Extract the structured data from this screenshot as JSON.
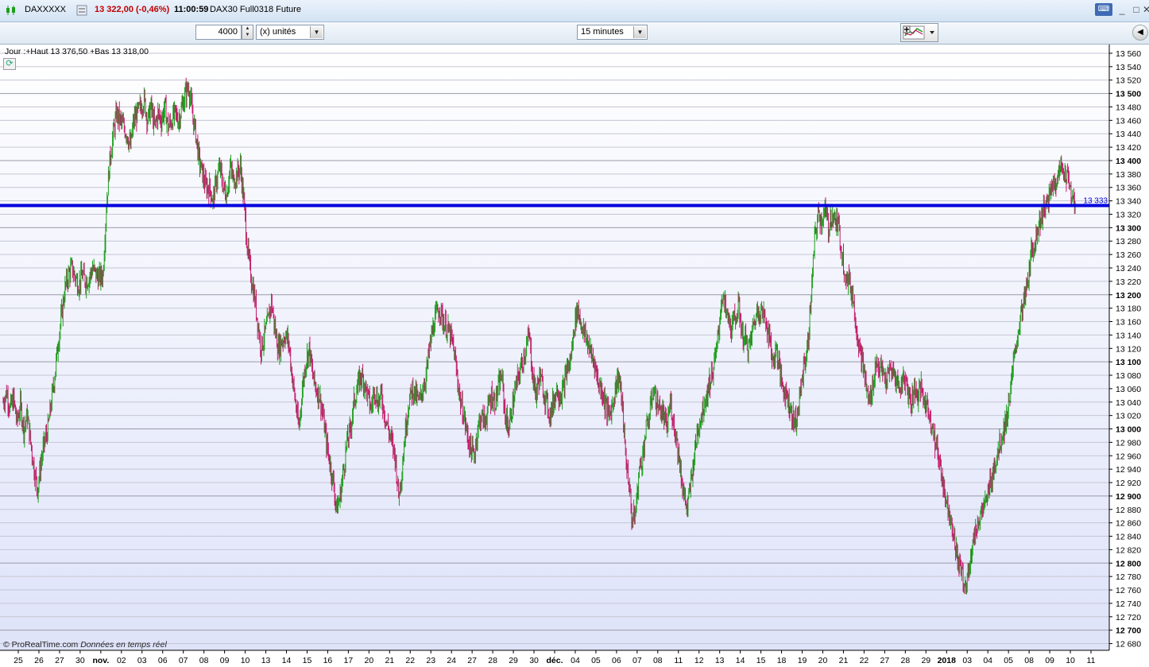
{
  "titlebar": {
    "symbol": "DAXXXXX",
    "price": "13 322,00 (-0,46%)",
    "time": "11:00:59",
    "instrument": "DAX30 Full0318 Future"
  },
  "toolbar": {
    "quantity_value": "4000",
    "units_label": "(x) unités",
    "period_label": "15 minutes"
  },
  "chart_info": "Jour :+Haut 13 376,50 +Bas 13 318,00",
  "footer": {
    "brand": "© ProRealTime.com",
    "note": "Données en temps réel"
  },
  "colors": {
    "up": "#1d9e1d",
    "down": "#c41869",
    "hline": "#0000dd"
  },
  "chart_data": {
    "type": "candlestick",
    "ylim": [
      12670,
      13573
    ],
    "hline": {
      "value": 13333,
      "label": "13 333"
    },
    "y_ticks": [
      {
        "v": 12680,
        "t": "12 680",
        "b": false
      },
      {
        "v": 12700,
        "t": "12 700",
        "b": true
      },
      {
        "v": 12720,
        "t": "12 720",
        "b": false
      },
      {
        "v": 12740,
        "t": "12 740",
        "b": false
      },
      {
        "v": 12760,
        "t": "12 760",
        "b": false
      },
      {
        "v": 12780,
        "t": "12 780",
        "b": false
      },
      {
        "v": 12800,
        "t": "12 800",
        "b": true
      },
      {
        "v": 12820,
        "t": "12 820",
        "b": false
      },
      {
        "v": 12840,
        "t": "12 840",
        "b": false
      },
      {
        "v": 12860,
        "t": "12 860",
        "b": false
      },
      {
        "v": 12880,
        "t": "12 880",
        "b": false
      },
      {
        "v": 12900,
        "t": "12 900",
        "b": true
      },
      {
        "v": 12920,
        "t": "12 920",
        "b": false
      },
      {
        "v": 12940,
        "t": "12 940",
        "b": false
      },
      {
        "v": 12960,
        "t": "12 960",
        "b": false
      },
      {
        "v": 12980,
        "t": "12 980",
        "b": false
      },
      {
        "v": 13000,
        "t": "13 000",
        "b": true
      },
      {
        "v": 13020,
        "t": "13 020",
        "b": false
      },
      {
        "v": 13040,
        "t": "13 040",
        "b": false
      },
      {
        "v": 13060,
        "t": "13 060",
        "b": false
      },
      {
        "v": 13080,
        "t": "13 080",
        "b": false
      },
      {
        "v": 13100,
        "t": "13 100",
        "b": true
      },
      {
        "v": 13120,
        "t": "13 120",
        "b": false
      },
      {
        "v": 13140,
        "t": "13 140",
        "b": false
      },
      {
        "v": 13160,
        "t": "13 160",
        "b": false
      },
      {
        "v": 13180,
        "t": "13 180",
        "b": false
      },
      {
        "v": 13200,
        "t": "13 200",
        "b": true
      },
      {
        "v": 13220,
        "t": "13 220",
        "b": false
      },
      {
        "v": 13240,
        "t": "13 240",
        "b": false
      },
      {
        "v": 13260,
        "t": "13 260",
        "b": false
      },
      {
        "v": 13280,
        "t": "13 280",
        "b": false
      },
      {
        "v": 13300,
        "t": "13 300",
        "b": true
      },
      {
        "v": 13320,
        "t": "13 320",
        "b": false
      },
      {
        "v": 13340,
        "t": "13 340",
        "b": false
      },
      {
        "v": 13360,
        "t": "13 360",
        "b": false
      },
      {
        "v": 13380,
        "t": "13 380",
        "b": false
      },
      {
        "v": 13400,
        "t": "13 400",
        "b": true
      },
      {
        "v": 13420,
        "t": "13 420",
        "b": false
      },
      {
        "v": 13440,
        "t": "13 440",
        "b": false
      },
      {
        "v": 13460,
        "t": "13 460",
        "b": false
      },
      {
        "v": 13480,
        "t": "13 480",
        "b": false
      },
      {
        "v": 13500,
        "t": "13 500",
        "b": true
      },
      {
        "v": 13520,
        "t": "13 520",
        "b": false
      },
      {
        "v": 13540,
        "t": "13 540",
        "b": false
      },
      {
        "v": 13560,
        "t": "13 560",
        "b": false
      }
    ],
    "x_labels": [
      {
        "t": "25",
        "b": false
      },
      {
        "t": "26",
        "b": false
      },
      {
        "t": "27",
        "b": false
      },
      {
        "t": "30",
        "b": false
      },
      {
        "t": "nov.",
        "b": true
      },
      {
        "t": "02",
        "b": false
      },
      {
        "t": "03",
        "b": false
      },
      {
        "t": "06",
        "b": false
      },
      {
        "t": "07",
        "b": false
      },
      {
        "t": "08",
        "b": false
      },
      {
        "t": "09",
        "b": false
      },
      {
        "t": "10",
        "b": false
      },
      {
        "t": "13",
        "b": false
      },
      {
        "t": "14",
        "b": false
      },
      {
        "t": "15",
        "b": false
      },
      {
        "t": "16",
        "b": false
      },
      {
        "t": "17",
        "b": false
      },
      {
        "t": "20",
        "b": false
      },
      {
        "t": "21",
        "b": false
      },
      {
        "t": "22",
        "b": false
      },
      {
        "t": "23",
        "b": false
      },
      {
        "t": "24",
        "b": false
      },
      {
        "t": "27",
        "b": false
      },
      {
        "t": "28",
        "b": false
      },
      {
        "t": "29",
        "b": false
      },
      {
        "t": "30",
        "b": false
      },
      {
        "t": "déc.",
        "b": true
      },
      {
        "t": "04",
        "b": false
      },
      {
        "t": "05",
        "b": false
      },
      {
        "t": "06",
        "b": false
      },
      {
        "t": "07",
        "b": false
      },
      {
        "t": "08",
        "b": false
      },
      {
        "t": "11",
        "b": false
      },
      {
        "t": "12",
        "b": false
      },
      {
        "t": "13",
        "b": false
      },
      {
        "t": "14",
        "b": false
      },
      {
        "t": "15",
        "b": false
      },
      {
        "t": "18",
        "b": false
      },
      {
        "t": "19",
        "b": false
      },
      {
        "t": "20",
        "b": false
      },
      {
        "t": "21",
        "b": false
      },
      {
        "t": "22",
        "b": false
      },
      {
        "t": "27",
        "b": false
      },
      {
        "t": "28",
        "b": false
      },
      {
        "t": "29",
        "b": false
      },
      {
        "t": "2018",
        "b": true
      },
      {
        "t": "03",
        "b": false
      },
      {
        "t": "04",
        "b": false
      },
      {
        "t": "05",
        "b": false
      },
      {
        "t": "08",
        "b": false
      },
      {
        "t": "09",
        "b": false
      },
      {
        "t": "10",
        "b": false
      },
      {
        "t": "11",
        "b": false
      }
    ],
    "price_path": [
      13040,
      13055,
      13030,
      13045,
      13010,
      13035,
      13000,
      13020,
      12980,
      12940,
      12910,
      12950,
      12980,
      13000,
      13040,
      13080,
      13130,
      13170,
      13210,
      13230,
      13240,
      13225,
      13215,
      13230,
      13220,
      13225,
      13240,
      13230,
      13225,
      13230,
      13330,
      13400,
      13440,
      13470,
      13460,
      13450,
      13440,
      13420,
      13460,
      13470,
      13480,
      13490,
      13460,
      13480,
      13450,
      13470,
      13460,
      13480,
      13450,
      13460,
      13470,
      13460,
      13480,
      13500,
      13510,
      13470,
      13440,
      13400,
      13380,
      13360,
      13360,
      13340,
      13370,
      13390,
      13360,
      13350,
      13390,
      13370,
      13380,
      13390,
      13340,
      13270,
      13230,
      13200,
      13160,
      13120,
      13140,
      13160,
      13190,
      13150,
      13120,
      13130,
      13140,
      13130,
      13080,
      13040,
      13000,
      13060,
      13100,
      13120,
      13080,
      13060,
      13050,
      13020,
      12980,
      12950,
      12920,
      12880,
      12900,
      12940,
      12980,
      13000,
      13040,
      13060,
      13080,
      13070,
      13050,
      13030,
      13060,
      13040,
      13050,
      13020,
      13000,
      12980,
      12960,
      12900,
      12940,
      13000,
      13040,
      13060,
      13050,
      13040,
      13060,
      13080,
      13120,
      13150,
      13170,
      13180,
      13160,
      13150,
      13140,
      13120,
      13080,
      13040,
      13020,
      12990,
      12970,
      12960,
      13000,
      13020,
      13010,
      13030,
      13050,
      13040,
      13060,
      13080,
      13020,
      13000,
      13030,
      13060,
      13080,
      13100,
      13120,
      13140,
      13080,
      13050,
      13080,
      13060,
      13040,
      13020,
      13040,
      13060,
      13050,
      13060,
      13090,
      13100,
      13150,
      13180,
      13160,
      13140,
      13130,
      13110,
      13100,
      13070,
      13060,
      13040,
      13020,
      13030,
      13060,
      13080,
      13040,
      12960,
      12920,
      12860,
      12880,
      12940,
      12960,
      13000,
      13020,
      13060,
      13040,
      13030,
      13020,
      13000,
      13040,
      13010,
      12980,
      12940,
      12900,
      12880,
      12920,
      12960,
      13000,
      13020,
      13040,
      13060,
      13080,
      13100,
      13140,
      13200,
      13180,
      13160,
      13150,
      13170,
      13180,
      13140,
      13130,
      13120,
      13150,
      13170,
      13180,
      13170,
      13160,
      13130,
      13100,
      13120,
      13080,
      13060,
      13050,
      13030,
      13010,
      13020,
      13060,
      13100,
      13120,
      13200,
      13280,
      13320,
      13310,
      13325,
      13300,
      13320,
      13310,
      13300,
      13260,
      13230,
      13220,
      13200,
      13160,
      13120,
      13100,
      13060,
      13040,
      13070,
      13100,
      13090,
      13080,
      13070,
      13090,
      13080,
      13070,
      13060,
      13080,
      13060,
      13040,
      13060,
      13050,
      13060,
      13040,
      13030,
      13010,
      12980,
      12960,
      12930,
      12900,
      12880,
      12860,
      12820,
      12800,
      12780,
      12760,
      12800,
      12830,
      12850,
      12870,
      12880,
      12890,
      12920,
      12940,
      12960,
      12980,
      13000,
      13020,
      13060,
      13100,
      13140,
      13170,
      13190,
      13220,
      13260,
      13280,
      13300,
      13320,
      13330,
      13340,
      13360,
      13370,
      13380,
      13390,
      13380,
      13370,
      13340,
      13330
    ]
  }
}
